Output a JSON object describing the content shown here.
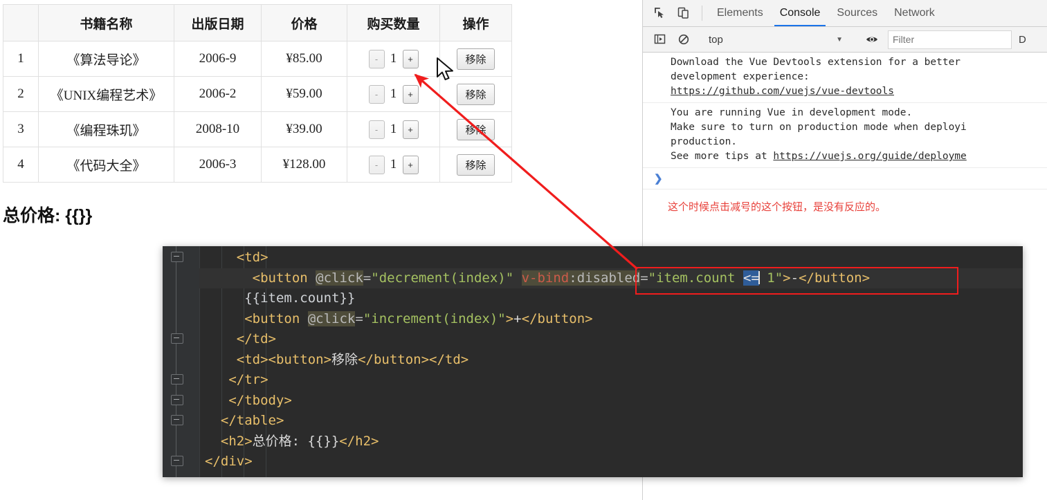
{
  "page": {
    "table": {
      "headers": [
        "",
        "书籍名称",
        "出版日期",
        "价格",
        "购买数量",
        "操作"
      ],
      "rows": [
        {
          "index": "1",
          "name": "《算法导论》",
          "date": "2006-9",
          "price": "¥85.00",
          "count": "1"
        },
        {
          "index": "2",
          "name": "《UNIX编程艺术》",
          "date": "2006-2",
          "price": "¥59.00",
          "count": "1"
        },
        {
          "index": "3",
          "name": "《编程珠玑》",
          "date": "2008-10",
          "price": "¥39.00",
          "count": "1"
        },
        {
          "index": "4",
          "name": "《代码大全》",
          "date": "2006-3",
          "price": "¥128.00",
          "count": "1"
        }
      ],
      "decrement_label": "-",
      "increment_label": "+",
      "remove_label": "移除"
    },
    "total_heading": "总价格: {{}}"
  },
  "devtools": {
    "icons": {
      "inspect": "inspect-element-icon",
      "device": "device-toolbar-icon"
    },
    "tabs": [
      {
        "label": "Elements",
        "active": false
      },
      {
        "label": "Console",
        "active": true
      },
      {
        "label": "Sources",
        "active": false
      },
      {
        "label": "Network",
        "active": false
      }
    ],
    "toolbar": {
      "context": "top",
      "filter_placeholder": "Filter",
      "levels_label": "D"
    },
    "console_messages": [
      {
        "lines": [
          "Download the Vue Devtools extension for a better",
          "development experience:"
        ],
        "link": "https://github.com/vuejs/vue-devtools"
      },
      {
        "lines": [
          "You are running Vue in development mode.",
          "Make sure to turn on production mode when deployi",
          "production."
        ],
        "tail_prefix": "See more tips at ",
        "link": "https://vuejs.org/guide/deployme"
      }
    ],
    "annotation_note": "这个时候点击减号的这个按钮，是没有反应的。"
  },
  "editor": {
    "lines": [
      {
        "id": "l0",
        "segments": [
          {
            "t": "    ",
            "c": "txt"
          },
          {
            "t": "<td>",
            "c": "tag"
          }
        ]
      },
      {
        "id": "l1",
        "segments": [
          {
            "t": "      ",
            "c": "txt"
          },
          {
            "t": "<button ",
            "c": "tag"
          },
          {
            "t": "@click",
            "c": "attr"
          },
          {
            "t": "=",
            "c": "attr2"
          },
          {
            "t": "\"decrement(index)\"",
            "c": "str"
          },
          {
            "t": " ",
            "c": "txt"
          },
          {
            "t": "v-bind",
            "c": "vbind"
          },
          {
            "t": ":disabled",
            "c": "attr"
          },
          {
            "t": "=",
            "c": "attr2"
          },
          {
            "t": "\"item.count ",
            "c": "str"
          },
          {
            "t": "<=",
            "c": "sel"
          },
          {
            "t": " 1\"",
            "c": "str"
          },
          {
            "t": ">",
            "c": "tag"
          },
          {
            "t": "-",
            "c": "txt"
          },
          {
            "t": "</button>",
            "c": "tag"
          }
        ]
      },
      {
        "id": "l2",
        "segments": [
          {
            "t": "     ",
            "c": "txt"
          },
          {
            "t": "{{item.count}}",
            "c": "mus"
          }
        ]
      },
      {
        "id": "l3",
        "segments": [
          {
            "t": "     ",
            "c": "txt"
          },
          {
            "t": "<button ",
            "c": "tag"
          },
          {
            "t": "@click",
            "c": "attr"
          },
          {
            "t": "=",
            "c": "attr2"
          },
          {
            "t": "\"increment(index)\"",
            "c": "str"
          },
          {
            "t": ">",
            "c": "tag"
          },
          {
            "t": "+",
            "c": "txt"
          },
          {
            "t": "</button>",
            "c": "tag"
          }
        ]
      },
      {
        "id": "l4",
        "segments": [
          {
            "t": "    ",
            "c": "txt"
          },
          {
            "t": "</td>",
            "c": "tag"
          }
        ]
      },
      {
        "id": "l5",
        "segments": [
          {
            "t": "    ",
            "c": "txt"
          },
          {
            "t": "<td><button>",
            "c": "tag"
          },
          {
            "t": "移除",
            "c": "txt"
          },
          {
            "t": "</button></td>",
            "c": "tag"
          }
        ]
      },
      {
        "id": "l6",
        "segments": [
          {
            "t": "   ",
            "c": "txt"
          },
          {
            "t": "</tr>",
            "c": "tag"
          }
        ]
      },
      {
        "id": "l7",
        "segments": [
          {
            "t": "   ",
            "c": "txt"
          },
          {
            "t": "</tbody>",
            "c": "tag"
          }
        ]
      },
      {
        "id": "l8",
        "segments": [
          {
            "t": "  ",
            "c": "txt"
          },
          {
            "t": "</table>",
            "c": "tag"
          }
        ]
      },
      {
        "id": "l9",
        "segments": [
          {
            "t": "  ",
            "c": "txt"
          },
          {
            "t": "<h2>",
            "c": "tag"
          },
          {
            "t": "总价格: {{}}",
            "c": "txt"
          },
          {
            "t": "</h2>",
            "c": "tag"
          }
        ]
      },
      {
        "id": "l10",
        "segments": [
          {
            "t": "</div>",
            "c": "tag"
          }
        ]
      }
    ]
  },
  "colors": {
    "accent_blue": "#1a73e8",
    "annotation_red": "#e8403a",
    "arrow_red": "#f01d1d",
    "editor_bg": "#2b2b2b",
    "gutter_bg": "#313335"
  }
}
